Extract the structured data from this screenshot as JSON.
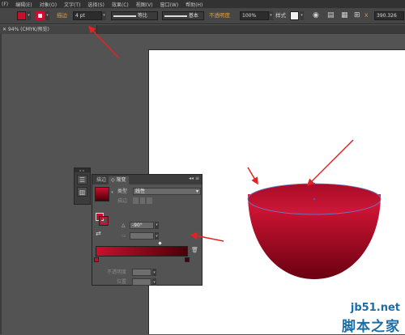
{
  "menubar": {
    "items": [
      "(F)",
      "编辑(E)",
      "对象(O)",
      "文字(T)",
      "选择(S)",
      "效果(C)",
      "视图(V)",
      "窗口(W)",
      "帮助(H)"
    ]
  },
  "controlbar": {
    "fill_color": "#c8102e",
    "stroke_color": "#c8102e",
    "stroke_label": "描边",
    "stroke_weight": "4 pt",
    "profile_label": "等比",
    "brush_label": "基本",
    "opacity_label": "不透明度",
    "opacity_value": "100%",
    "style_label": "样式",
    "x_label": "X",
    "x_value": "390.326"
  },
  "document_tab": {
    "title": "94% (CMYK/预览)"
  },
  "gradient_panel": {
    "tab_stroke": "描边",
    "tab_gradient": "渐变",
    "type_label": "类型",
    "type_value": "线性",
    "stroke_label": "描边",
    "angle_value": "-90°",
    "opacity_label": "不透明度",
    "location_label": "位置",
    "gradient_start": "#c8102e",
    "gradient_end": "#4a0008"
  },
  "bowl": {
    "rim_color": "#b8102b",
    "body_top": "#e0183a",
    "body_bottom": "#6a0010"
  },
  "annotation": {
    "arrow_color": "#e82020"
  },
  "watermark": {
    "site": "jb51.net",
    "name": "脚本之家"
  }
}
